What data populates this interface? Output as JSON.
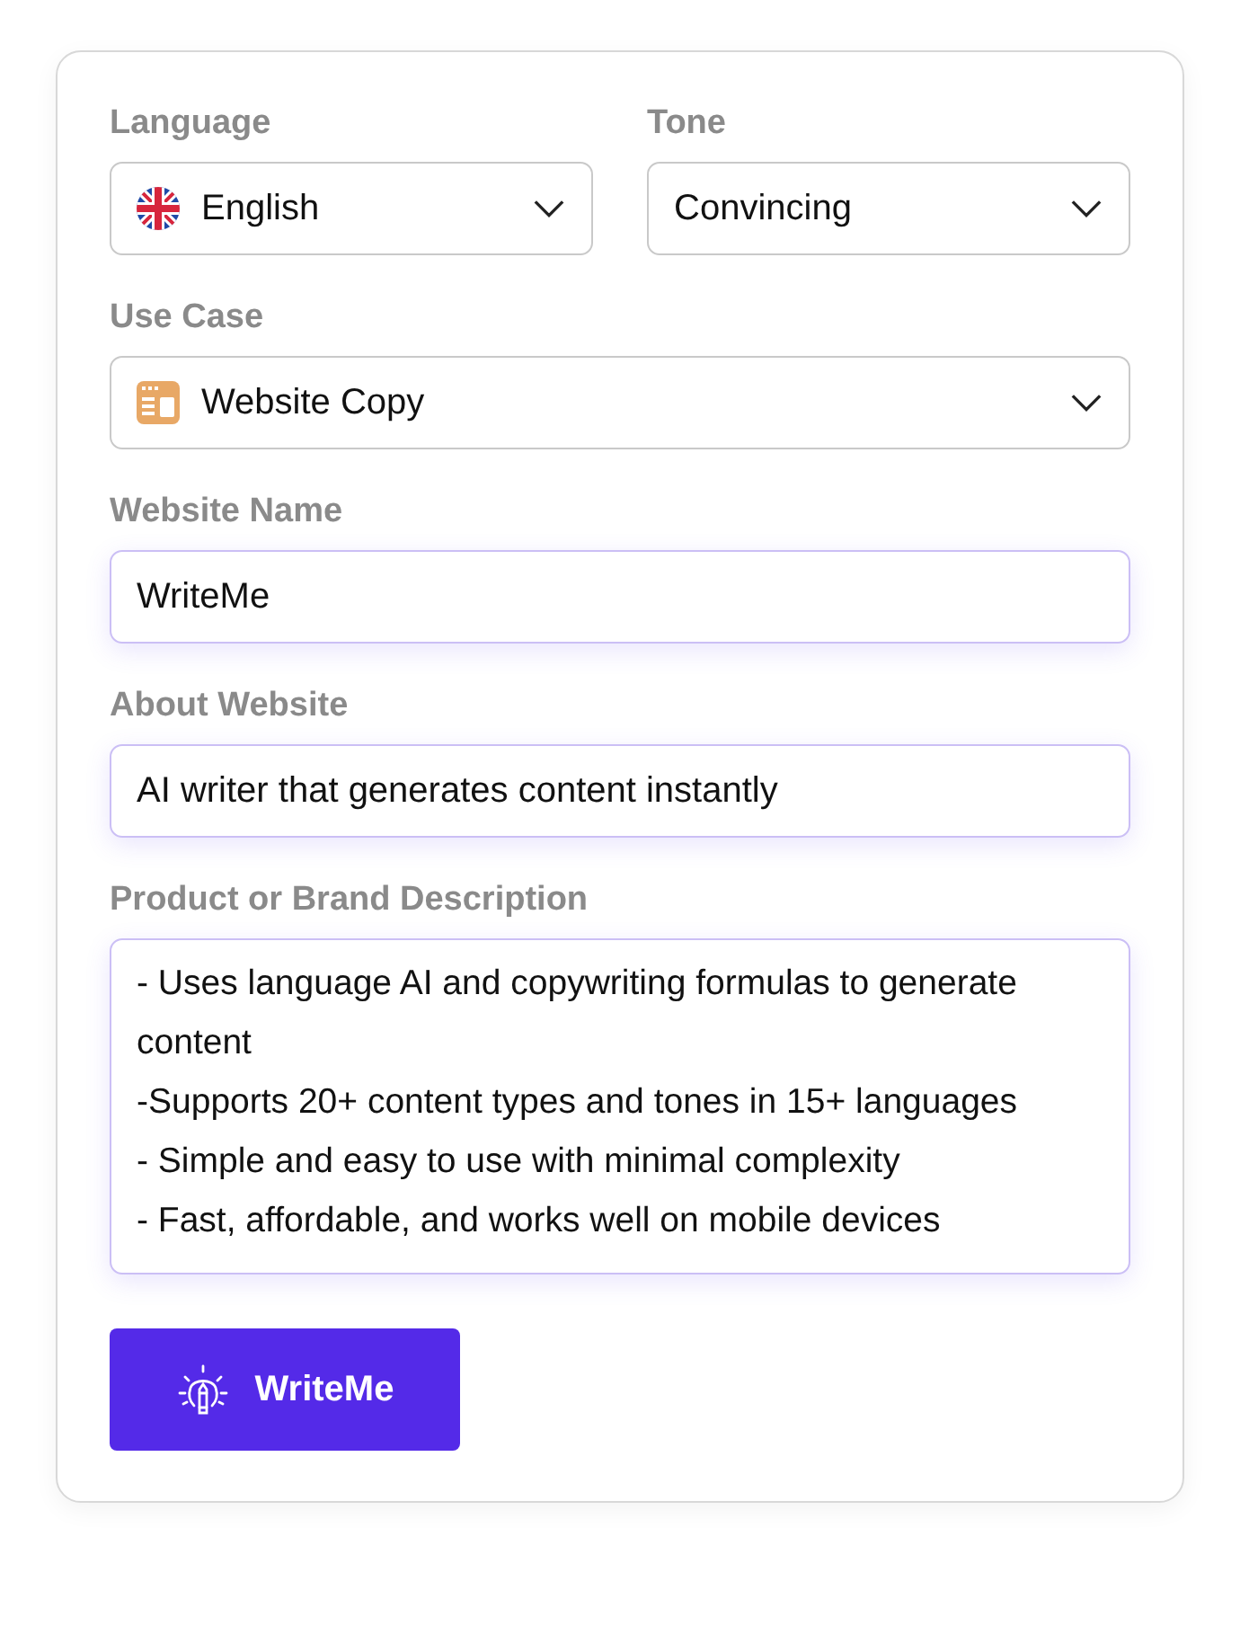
{
  "row": [
    {
      "label": "Language",
      "kind": "select",
      "value": "English"
    },
    {
      "label": "Tone",
      "kind": "select",
      "value": "Convincing"
    }
  ],
  "fields": [
    {
      "label": "Use Case",
      "kind": "select",
      "value": "Website Copy"
    },
    {
      "label": "Website Name",
      "kind": "input",
      "value": "WriteMe"
    },
    {
      "label": "About Website",
      "kind": "input",
      "value": "AI writer that generates content instantly"
    },
    {
      "label": "Product or Brand Description",
      "kind": "textarea",
      "value": "- Uses language AI and copywriting formulas to generate content\n-Supports 20+ content types and tones in 15+ languages\n- Simple and easy to use with minimal complexity\n- Fast, affordable, and works well on mobile devices"
    }
  ],
  "button": {
    "label": "WriteMe"
  }
}
